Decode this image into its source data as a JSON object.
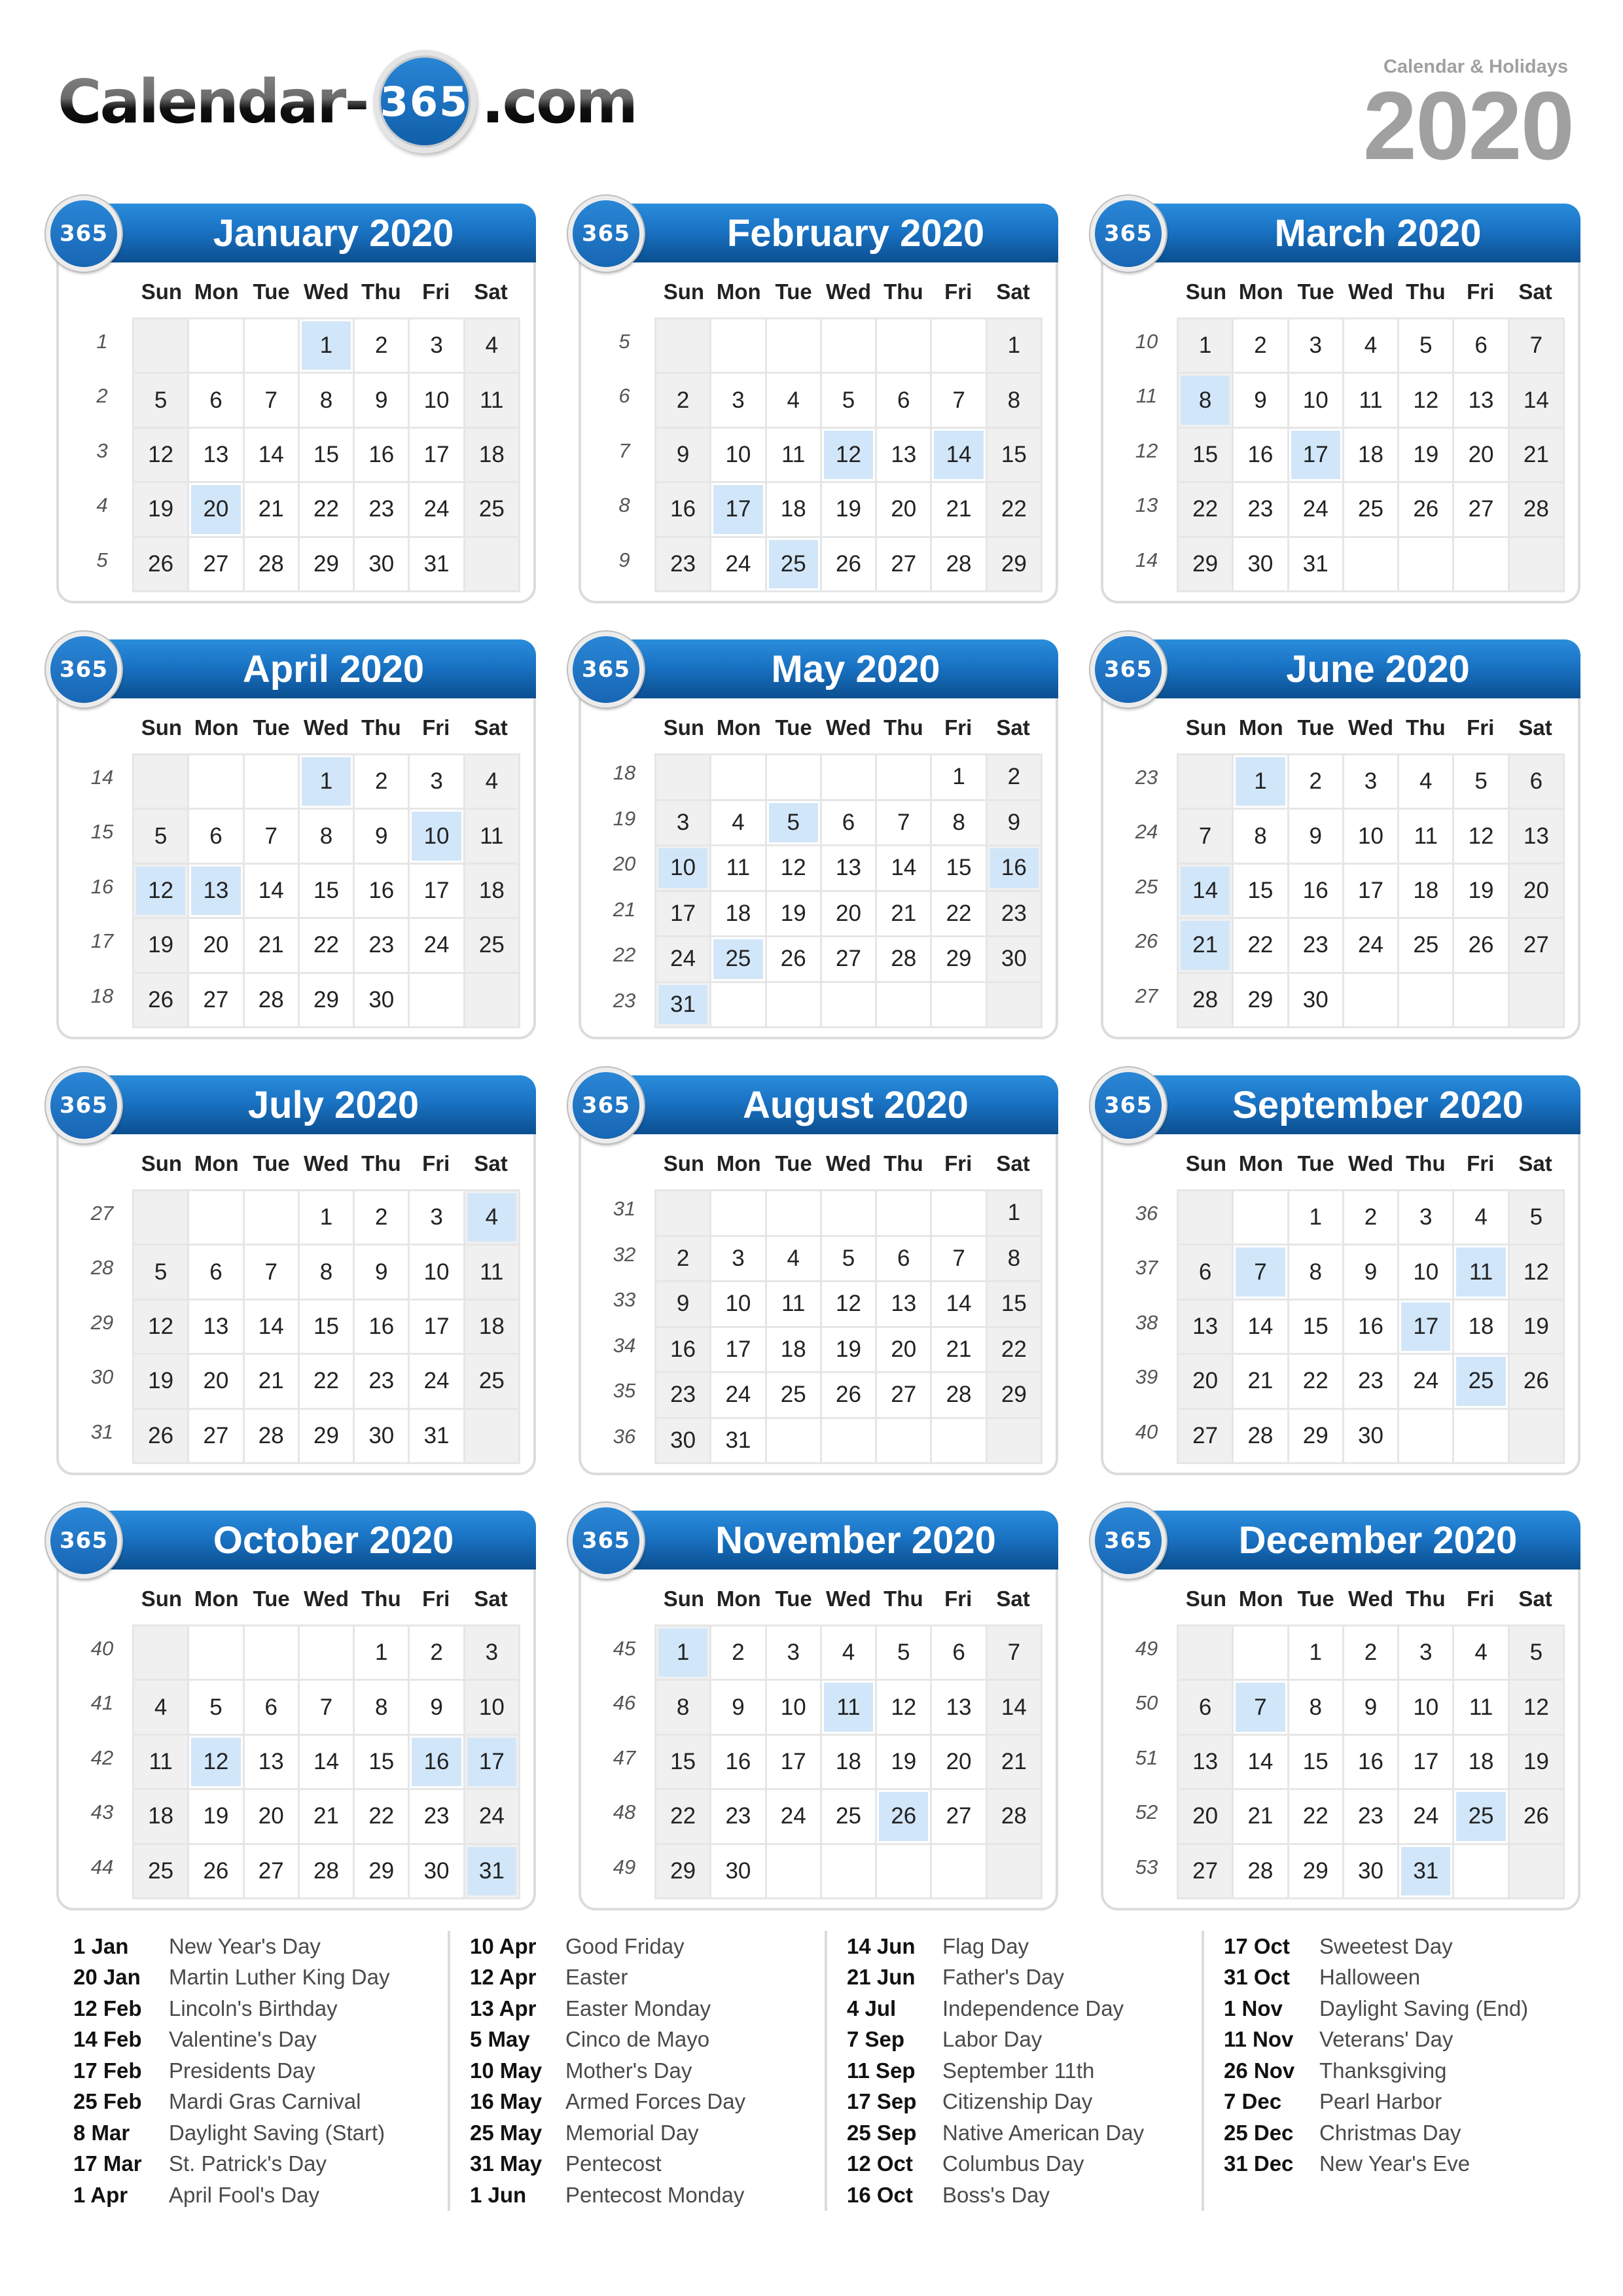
{
  "brand": {
    "logo_left": "Calendar-",
    "logo_badge": "365",
    "logo_right": ".com",
    "subtitle": "Calendar & Holidays",
    "year": "2020"
  },
  "badge_label": "365",
  "weekdays": [
    "Sun",
    "Mon",
    "Tue",
    "Wed",
    "Thu",
    "Fri",
    "Sat"
  ],
  "colors": {
    "header_blue": "#1a73c4",
    "holiday_highlight": "#d2e6f9",
    "weekend_cell": "#f0f0f0",
    "year_gray": "#a0a0a0"
  },
  "months": [
    {
      "title": "January 2020",
      "start": 3,
      "days": 31,
      "weeks": [
        "1",
        "2",
        "3",
        "4",
        "5"
      ],
      "holidays": [
        1,
        20
      ]
    },
    {
      "title": "February 2020",
      "start": 6,
      "days": 29,
      "weeks": [
        "5",
        "6",
        "7",
        "8",
        "9"
      ],
      "holidays": [
        12,
        14,
        17,
        25
      ]
    },
    {
      "title": "March 2020",
      "start": 0,
      "days": 31,
      "weeks": [
        "10",
        "11",
        "12",
        "13",
        "14"
      ],
      "holidays": [
        8,
        17
      ]
    },
    {
      "title": "April 2020",
      "start": 3,
      "days": 30,
      "weeks": [
        "14",
        "15",
        "16",
        "17",
        "18"
      ],
      "holidays": [
        1,
        10,
        12,
        13
      ]
    },
    {
      "title": "May 2020",
      "start": 5,
      "days": 31,
      "weeks": [
        "18",
        "19",
        "20",
        "21",
        "22",
        "23"
      ],
      "holidays": [
        5,
        10,
        16,
        25,
        31
      ]
    },
    {
      "title": "June 2020",
      "start": 1,
      "days": 30,
      "weeks": [
        "23",
        "24",
        "25",
        "26",
        "27"
      ],
      "holidays": [
        1,
        14,
        21
      ]
    },
    {
      "title": "July 2020",
      "start": 3,
      "days": 31,
      "weeks": [
        "27",
        "28",
        "29",
        "30",
        "31"
      ],
      "holidays": [
        4
      ]
    },
    {
      "title": "August 2020",
      "start": 6,
      "days": 31,
      "weeks": [
        "31",
        "32",
        "33",
        "34",
        "35",
        "36"
      ],
      "holidays": []
    },
    {
      "title": "September 2020",
      "start": 2,
      "days": 30,
      "weeks": [
        "36",
        "37",
        "38",
        "39",
        "40"
      ],
      "holidays": [
        7,
        11,
        17,
        25
      ]
    },
    {
      "title": "October 2020",
      "start": 4,
      "days": 31,
      "weeks": [
        "40",
        "41",
        "42",
        "43",
        "44"
      ],
      "holidays": [
        12,
        16,
        17,
        31
      ]
    },
    {
      "title": "November 2020",
      "start": 0,
      "days": 30,
      "weeks": [
        "45",
        "46",
        "47",
        "48",
        "49"
      ],
      "holidays": [
        1,
        11,
        26
      ]
    },
    {
      "title": "December 2020",
      "start": 2,
      "days": 31,
      "weeks": [
        "49",
        "50",
        "51",
        "52",
        "53"
      ],
      "holidays": [
        7,
        25,
        31
      ]
    }
  ],
  "holiday_list": [
    [
      {
        "date": "1 Jan",
        "name": "New Year's Day"
      },
      {
        "date": "20 Jan",
        "name": "Martin Luther King Day"
      },
      {
        "date": "12 Feb",
        "name": "Lincoln's Birthday"
      },
      {
        "date": "14 Feb",
        "name": "Valentine's Day"
      },
      {
        "date": "17 Feb",
        "name": "Presidents Day"
      },
      {
        "date": "25 Feb",
        "name": "Mardi Gras Carnival"
      },
      {
        "date": "8 Mar",
        "name": "Daylight Saving (Start)"
      },
      {
        "date": "17 Mar",
        "name": "St. Patrick's Day"
      },
      {
        "date": "1 Apr",
        "name": "April Fool's Day"
      }
    ],
    [
      {
        "date": "10 Apr",
        "name": "Good Friday"
      },
      {
        "date": "12 Apr",
        "name": "Easter"
      },
      {
        "date": "13 Apr",
        "name": "Easter Monday"
      },
      {
        "date": "5 May",
        "name": "Cinco de Mayo"
      },
      {
        "date": "10 May",
        "name": "Mother's Day"
      },
      {
        "date": "16 May",
        "name": "Armed Forces Day"
      },
      {
        "date": "25 May",
        "name": "Memorial Day"
      },
      {
        "date": "31 May",
        "name": "Pentecost"
      },
      {
        "date": "1 Jun",
        "name": "Pentecost Monday"
      }
    ],
    [
      {
        "date": "14 Jun",
        "name": "Flag Day"
      },
      {
        "date": "21 Jun",
        "name": "Father's Day"
      },
      {
        "date": "4 Jul",
        "name": "Independence Day"
      },
      {
        "date": "7 Sep",
        "name": "Labor Day"
      },
      {
        "date": "11 Sep",
        "name": "September 11th"
      },
      {
        "date": "17 Sep",
        "name": "Citizenship Day"
      },
      {
        "date": "25 Sep",
        "name": "Native American Day"
      },
      {
        "date": "12 Oct",
        "name": "Columbus Day"
      },
      {
        "date": "16 Oct",
        "name": "Boss's Day"
      }
    ],
    [
      {
        "date": "17 Oct",
        "name": "Sweetest Day"
      },
      {
        "date": "31 Oct",
        "name": "Halloween"
      },
      {
        "date": "1 Nov",
        "name": "Daylight Saving (End)"
      },
      {
        "date": "11 Nov",
        "name": "Veterans' Day"
      },
      {
        "date": "26 Nov",
        "name": "Thanksgiving"
      },
      {
        "date": "7 Dec",
        "name": "Pearl Harbor"
      },
      {
        "date": "25 Dec",
        "name": "Christmas Day"
      },
      {
        "date": "31 Dec",
        "name": "New Year's Eve"
      }
    ]
  ]
}
